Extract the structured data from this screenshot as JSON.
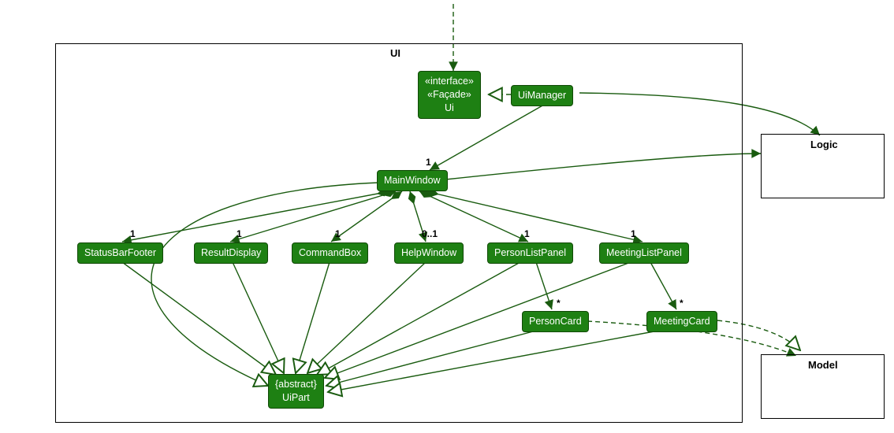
{
  "packages": {
    "ui": {
      "label": "UI"
    },
    "logic": {
      "label": "Logic"
    },
    "model": {
      "label": "Model"
    }
  },
  "nodes": {
    "ui_iface": {
      "line1": "«interface»",
      "line2": "«Façade»",
      "line3": "Ui"
    },
    "uimanager": {
      "label": "UiManager"
    },
    "mainwindow": {
      "label": "MainWindow"
    },
    "statusbarfooter": {
      "label": "StatusBarFooter"
    },
    "resultdisplay": {
      "label": "ResultDisplay"
    },
    "commandbox": {
      "label": "CommandBox"
    },
    "helpwindow": {
      "label": "HelpWindow"
    },
    "personlistpanel": {
      "label": "PersonListPanel"
    },
    "meetinglistpanel": {
      "label": "MeetingListPanel"
    },
    "personcard": {
      "label": "PersonCard"
    },
    "meetingcard": {
      "label": "MeetingCard"
    },
    "uipart": {
      "line1": "{abstract}",
      "line2": "UiPart"
    }
  },
  "mult": {
    "mainwindow": "1",
    "statusbarfooter": "1",
    "resultdisplay": "1",
    "commandbox": "1",
    "helpwindow": "0..1",
    "personlistpanel": "1",
    "meetinglistpanel": "1",
    "personcard": "*",
    "meetingcard": "*"
  },
  "colors": {
    "node_fill": "#1e8013",
    "node_border": "#104906",
    "edge": "#195b0f"
  }
}
